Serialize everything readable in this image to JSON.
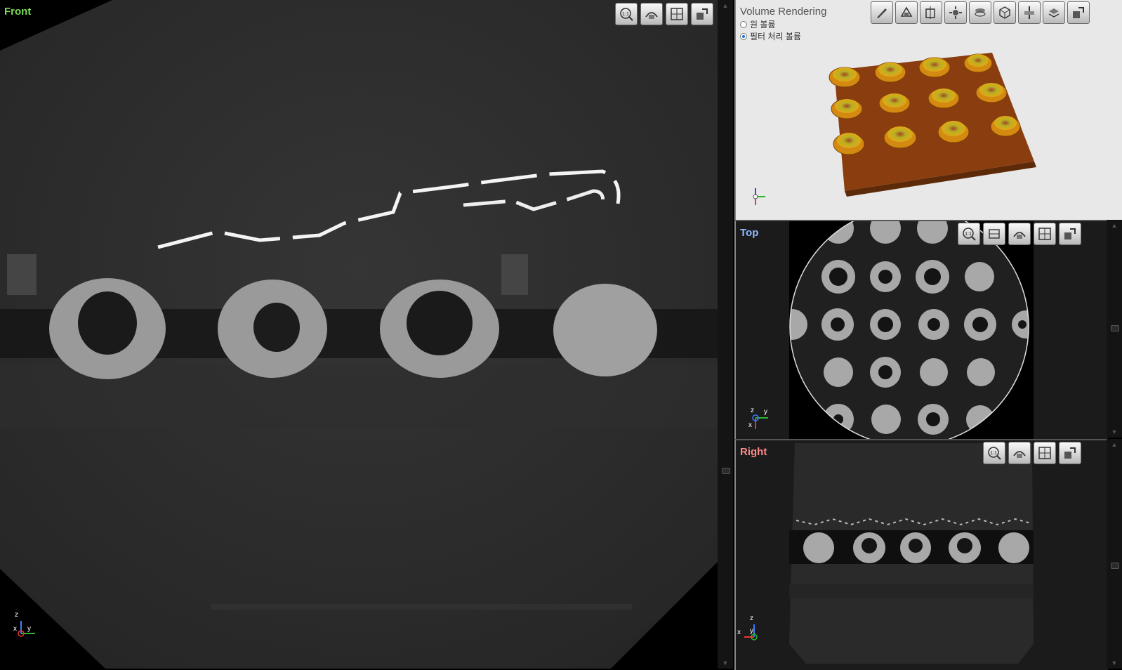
{
  "views": {
    "front": {
      "title": "Front",
      "axes": {
        "up": "z",
        "left": "x",
        "right": "y"
      }
    },
    "volume": {
      "title": "Volume Rendering",
      "options": [
        {
          "label": "원 볼륨",
          "selected": false
        },
        {
          "label": "필터 처리 볼륨",
          "selected": true
        }
      ]
    },
    "top": {
      "title": "Top",
      "axes": {
        "up": "z",
        "right": "y",
        "down": "x"
      }
    },
    "right": {
      "title": "Right",
      "axes": {
        "up": "z",
        "left": "x",
        "right": "y"
      }
    }
  },
  "toolbar": {
    "zoom_1to1_label": "1:1"
  },
  "colors": {
    "front_title": "#7ed957",
    "top_title": "#8fb8ff",
    "right_title": "#ff8a8a",
    "volume_bg": "#e8e8e8",
    "slice_bg": "#1b1b1b"
  }
}
